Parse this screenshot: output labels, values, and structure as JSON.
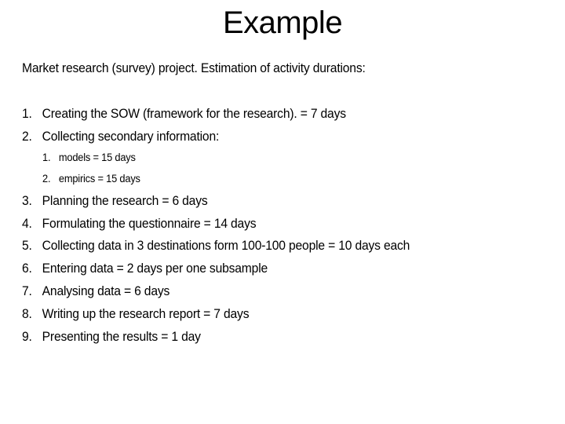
{
  "slide": {
    "title": "Example",
    "intro": "Market research (survey) project. Estimation of activity durations:",
    "items": [
      {
        "num": "1.",
        "text": "Creating the SOW (framework for the research). = 7 days"
      },
      {
        "num": "2.",
        "text": "Collecting secondary information:",
        "subitems": [
          {
            "num": "1.",
            "text": "models = 15 days"
          },
          {
            "num": "2.",
            "text": "empirics = 15 days"
          }
        ]
      },
      {
        "num": "3.",
        "text": "Planning the research = 6 days"
      },
      {
        "num": "4.",
        "text": "Formulating the questionnaire = 14 days"
      },
      {
        "num": "5.",
        "text": "Collecting data in 3 destinations form 100-100 people = 10 days each"
      },
      {
        "num": "6.",
        "text": "Entering data = 2 days per one subsample"
      },
      {
        "num": "7.",
        "text": "Analysing data = 6 days"
      },
      {
        "num": "8.",
        "text": "Writing up the research report = 7 days"
      },
      {
        "num": "9.",
        "text": "Presenting the results = 1 day"
      }
    ]
  }
}
